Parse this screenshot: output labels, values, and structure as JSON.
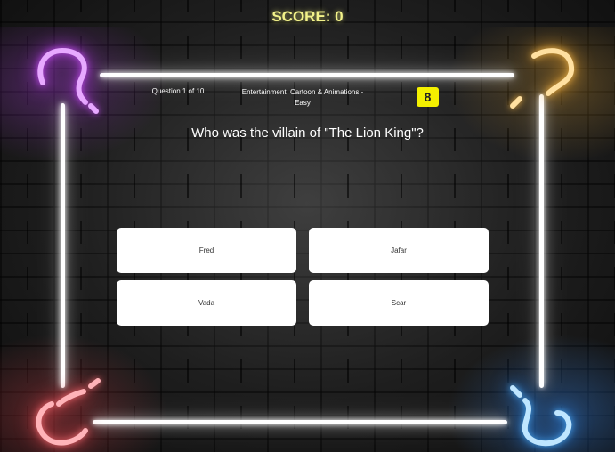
{
  "score": {
    "label": "SCORE: 0"
  },
  "quiz": {
    "progress_label": "Question 1 of 10",
    "category_label": "Entertainment: Cartoon & Animations - Easy",
    "timer": "8",
    "question": "Who was the villain of \"The Lion King\"?",
    "answers": [
      {
        "label": "Fred"
      },
      {
        "label": "Jafar"
      },
      {
        "label": "Vada"
      },
      {
        "label": "Scar"
      }
    ]
  },
  "colors": {
    "score_text": "#f2f28a",
    "timer_bg": "#f4f000",
    "neon_pink": "#d05cf0",
    "neon_orange": "#f3b64a",
    "neon_red": "#f06b72",
    "neon_blue": "#6cc3ff"
  },
  "icons": [
    "question-mark-neon-icon"
  ]
}
